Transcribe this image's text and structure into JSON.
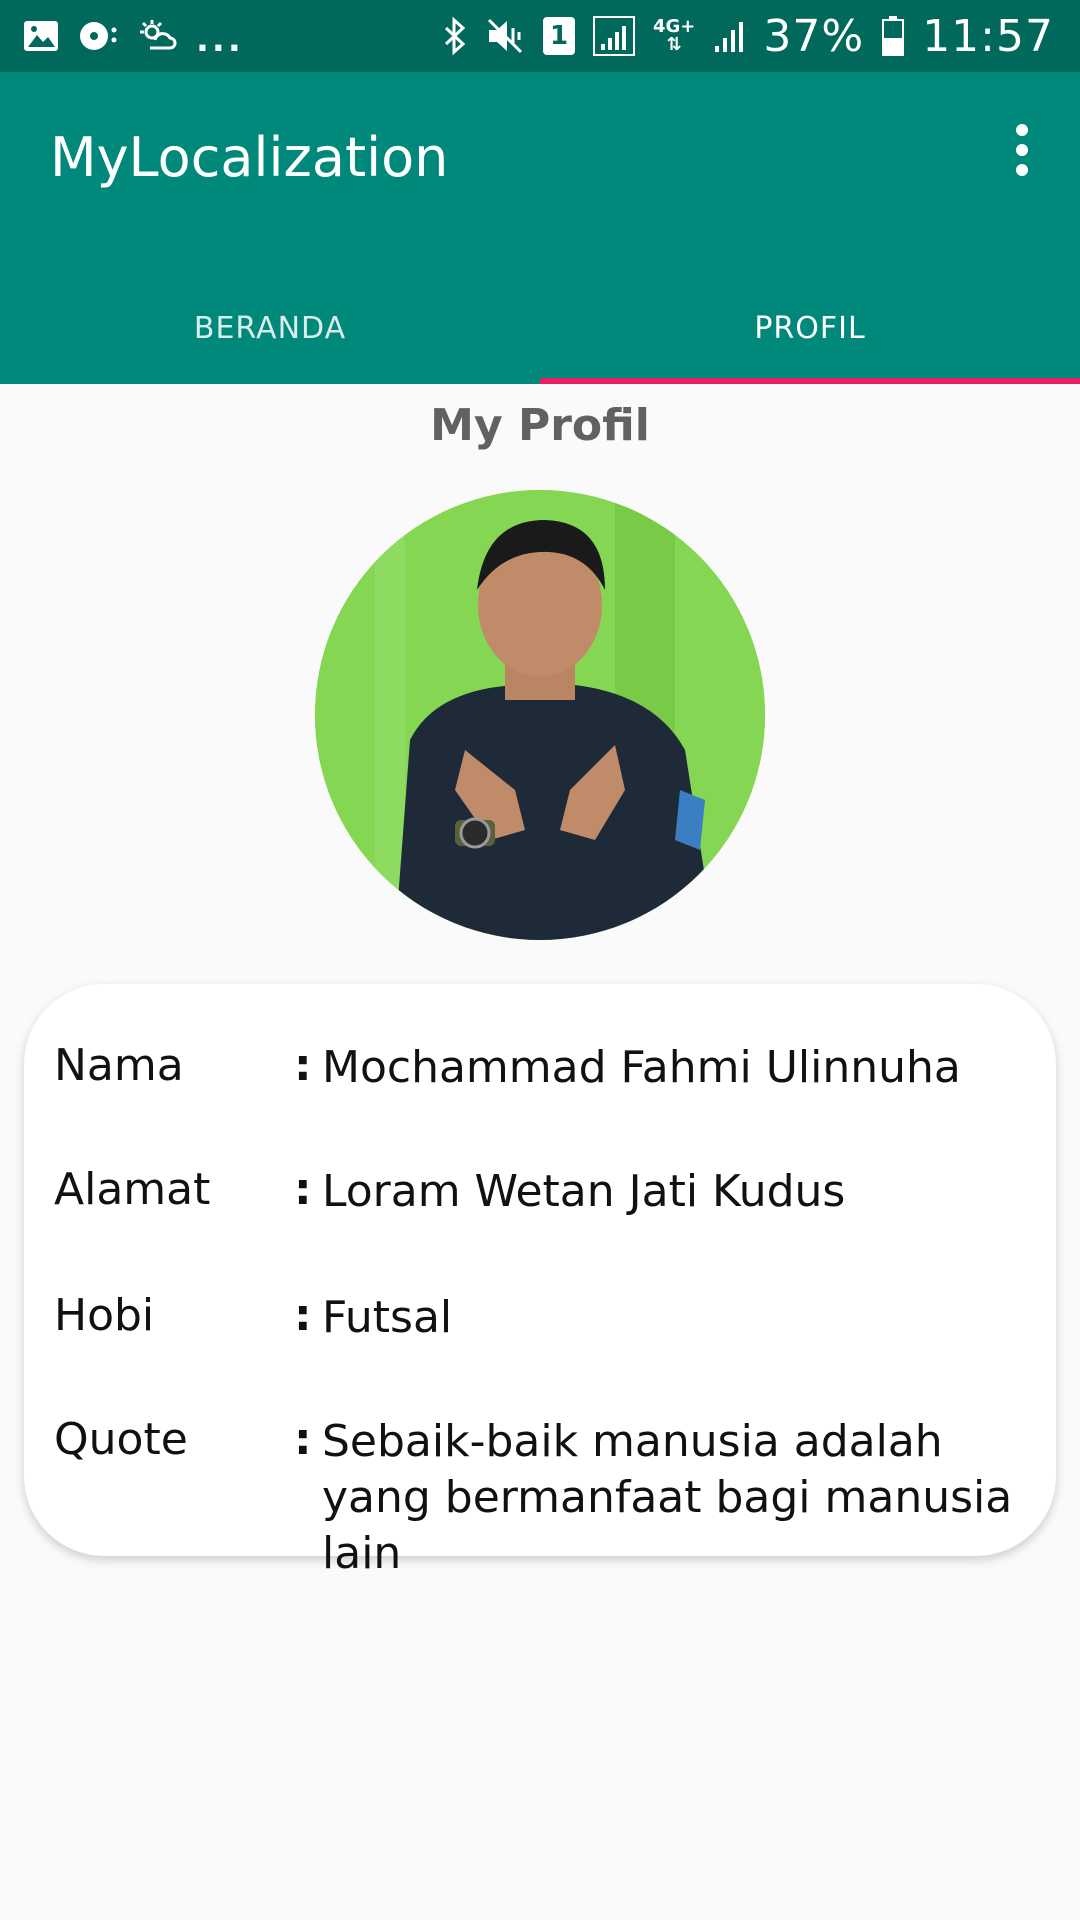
{
  "status_bar": {
    "left_icons": [
      "image-icon",
      "media-icon",
      "weather-icon"
    ],
    "more_indicator": "...",
    "sim_slot": "1",
    "network_type": "4G+",
    "battery": "37%",
    "time": "11:57"
  },
  "app_bar": {
    "title": "MyLocalization",
    "overflow_icon": "more-vert-icon"
  },
  "tabs": [
    {
      "label": "BERANDA",
      "selected": false
    },
    {
      "label": "PROFIL",
      "selected": true
    }
  ],
  "colors": {
    "status_bar": "#00695c",
    "primary": "#00897b",
    "tab_indicator": "#e91e63",
    "background": "#fafafa"
  },
  "profile": {
    "title": "My Profil",
    "rows": [
      {
        "label": "Nama",
        "separator": ":",
        "value": "Mochammad Fahmi Ulinnuha"
      },
      {
        "label": "Alamat",
        "separator": ":",
        "value": "Loram Wetan Jati Kudus"
      },
      {
        "label": "Hobi",
        "separator": ":",
        "value": "Futsal"
      },
      {
        "label": "Quote",
        "separator": ":",
        "value": "Sebaik-baik manusia adalah yang bermanfaat bagi manusia lain"
      }
    ]
  }
}
